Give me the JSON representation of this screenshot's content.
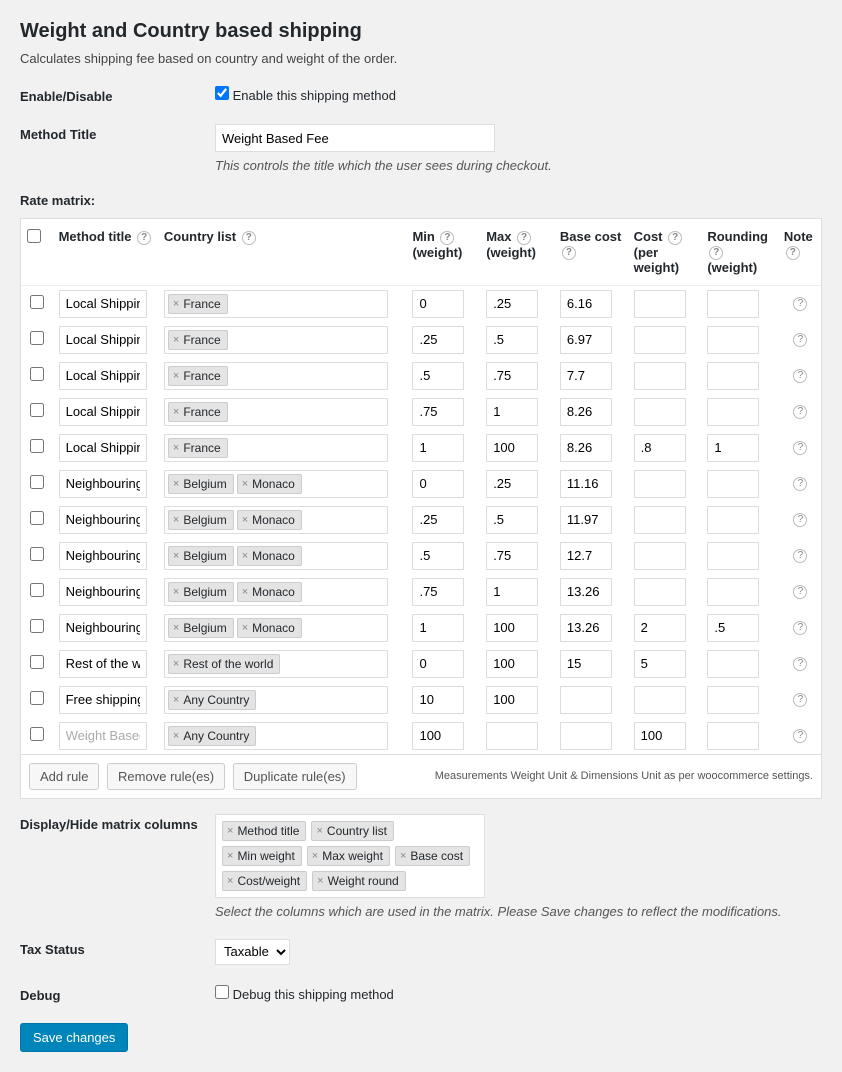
{
  "heading": "Weight and Country based shipping",
  "description": "Calculates shipping fee based on country and weight of the order.",
  "enable": {
    "label": "Enable/Disable",
    "checkbox_label": "Enable this shipping method",
    "checked": true
  },
  "method_title": {
    "label": "Method Title",
    "value": "Weight Based Fee",
    "help": "This controls the title which the user sees during checkout."
  },
  "rate_matrix_label": "Rate matrix:",
  "matrix": {
    "headers": {
      "method_title": "Method title",
      "country_list": "Country list",
      "min": "Min",
      "min_sub": "(weight)",
      "max": "Max",
      "max_sub": "(weight)",
      "base_cost": "Base cost",
      "cost": "Cost",
      "cost_sub": "(per weight)",
      "rounding": "Rounding",
      "rounding_sub": "(weight)",
      "note": "Note"
    },
    "rows": [
      {
        "title": "Local Shipping",
        "countries": [
          "France"
        ],
        "min": "0",
        "max": ".25",
        "base": "6.16",
        "cost": "",
        "round": ""
      },
      {
        "title": "Local Shipping",
        "countries": [
          "France"
        ],
        "min": ".25",
        "max": ".5",
        "base": "6.97",
        "cost": "",
        "round": ""
      },
      {
        "title": "Local Shipping",
        "countries": [
          "France"
        ],
        "min": ".5",
        "max": ".75",
        "base": "7.7",
        "cost": "",
        "round": ""
      },
      {
        "title": "Local Shipping",
        "countries": [
          "France"
        ],
        "min": ".75",
        "max": "1",
        "base": "8.26",
        "cost": "",
        "round": ""
      },
      {
        "title": "Local Shipping",
        "countries": [
          "France"
        ],
        "min": "1",
        "max": "100",
        "base": "8.26",
        "cost": ".8",
        "round": "1"
      },
      {
        "title": "Neighbouring !",
        "countries": [
          "Belgium",
          "Monaco"
        ],
        "min": "0",
        "max": ".25",
        "base": "11.16",
        "cost": "",
        "round": ""
      },
      {
        "title": "Neighbouring !",
        "countries": [
          "Belgium",
          "Monaco"
        ],
        "min": ".25",
        "max": ".5",
        "base": "11.97",
        "cost": "",
        "round": ""
      },
      {
        "title": "Neighbouring !",
        "countries": [
          "Belgium",
          "Monaco"
        ],
        "min": ".5",
        "max": ".75",
        "base": "12.7",
        "cost": "",
        "round": ""
      },
      {
        "title": "Neighbouring !",
        "countries": [
          "Belgium",
          "Monaco"
        ],
        "min": ".75",
        "max": "1",
        "base": "13.26",
        "cost": "",
        "round": ""
      },
      {
        "title": "Neighbouring !",
        "countries": [
          "Belgium",
          "Monaco"
        ],
        "min": "1",
        "max": "100",
        "base": "13.26",
        "cost": "2",
        "round": ".5"
      },
      {
        "title": "Rest of the wor",
        "countries": [
          "Rest of the world"
        ],
        "min": "0",
        "max": "100",
        "base": "15",
        "cost": "5",
        "round": ""
      },
      {
        "title": "Free shipping",
        "countries": [
          "Any Country"
        ],
        "min": "10",
        "max": "100",
        "base": "",
        "cost": "",
        "round": ""
      },
      {
        "title": "",
        "placeholder": "Weight Based l",
        "countries": [
          "Any Country"
        ],
        "min": "100",
        "max": "",
        "base": "",
        "cost": "100",
        "round": ""
      }
    ],
    "buttons": {
      "add": "Add rule",
      "remove": "Remove rule(es)",
      "duplicate": "Duplicate rule(es)"
    },
    "footer_note": "Measurements Weight Unit & Dimensions Unit as per woocommerce settings."
  },
  "columns": {
    "label": "Display/Hide matrix columns",
    "selected": [
      "Method title",
      "Country list",
      "Min weight",
      "Max weight",
      "Base cost",
      "Cost/weight",
      "Weight round"
    ],
    "help": "Select the columns which are used in the matrix. Please Save changes to reflect the modifications."
  },
  "tax_status": {
    "label": "Tax Status",
    "value": "Taxable"
  },
  "debug": {
    "label": "Debug",
    "checkbox_label": "Debug this shipping method",
    "checked": false
  },
  "save_button": "Save changes",
  "help_icon": "?"
}
